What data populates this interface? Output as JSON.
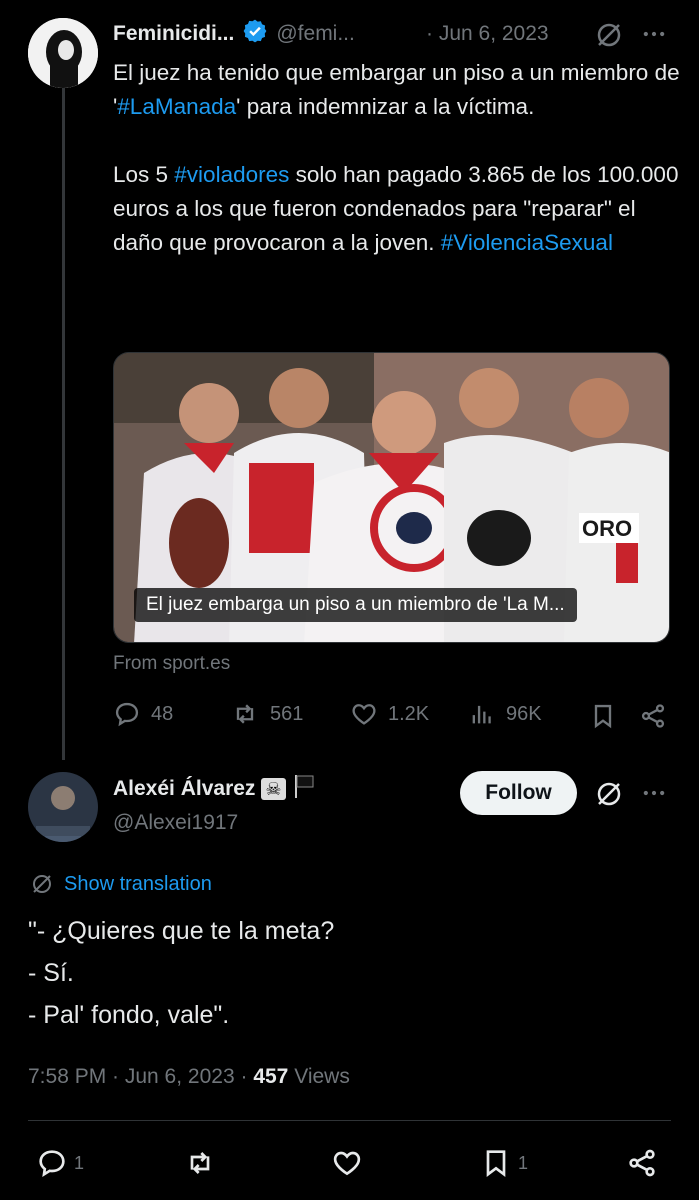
{
  "tweet1": {
    "author_name": "Feminicidi...",
    "handle": "@femi...",
    "date": "· Jun 6, 2023",
    "text_lines": [
      [
        "El juez ha tenido que embargar un piso a un",
        null
      ],
      [
        "miembro de '",
        "#LaManada",
        "' para indemnizar a la"
      ],
      [
        "víctima."
      ]
    ],
    "para1_a": "El juez ha tenido que embargar un piso a un miembro de '",
    "para1_tag": "#LaManada",
    "para1_b": "' para indemnizar a la víctima.",
    "para2_a": "Los 5 ",
    "para2_tag1": "#violadores",
    "para2_b": " solo han pagado 3.865 de los 100.000 euros a los que fueron condenados para \"reparar\" el daño que provocaron a la joven. ",
    "para2_tag2": "#ViolenciaSexual",
    "media_caption": "El juez embarga un piso a un miembro de 'La M...",
    "source": "From sport.es",
    "stats": {
      "replies": "48",
      "reposts": "561",
      "likes": "1.2K",
      "views": "96K"
    }
  },
  "tweet2": {
    "author_name": "Alexéi Álvarez",
    "author_emoji": "☠",
    "handle": "@Alexei1917",
    "follow_label": "Follow",
    "show_translation": "Show translation",
    "body_lines": [
      "\"- ¿Quieres que te la meta?",
      "- Sí.",
      "- Pal' fondo, vale\"."
    ],
    "timestamp": "7:58 PM · Jun 6, 2023 ·",
    "views_count": "457",
    "views_label": "Views",
    "stats": {
      "replies": "1",
      "bookmarks": "1"
    }
  },
  "colors": {
    "accent": "#1d9bf0",
    "background": "#000000",
    "text": "#e7e9ea",
    "muted": "#71767b"
  }
}
